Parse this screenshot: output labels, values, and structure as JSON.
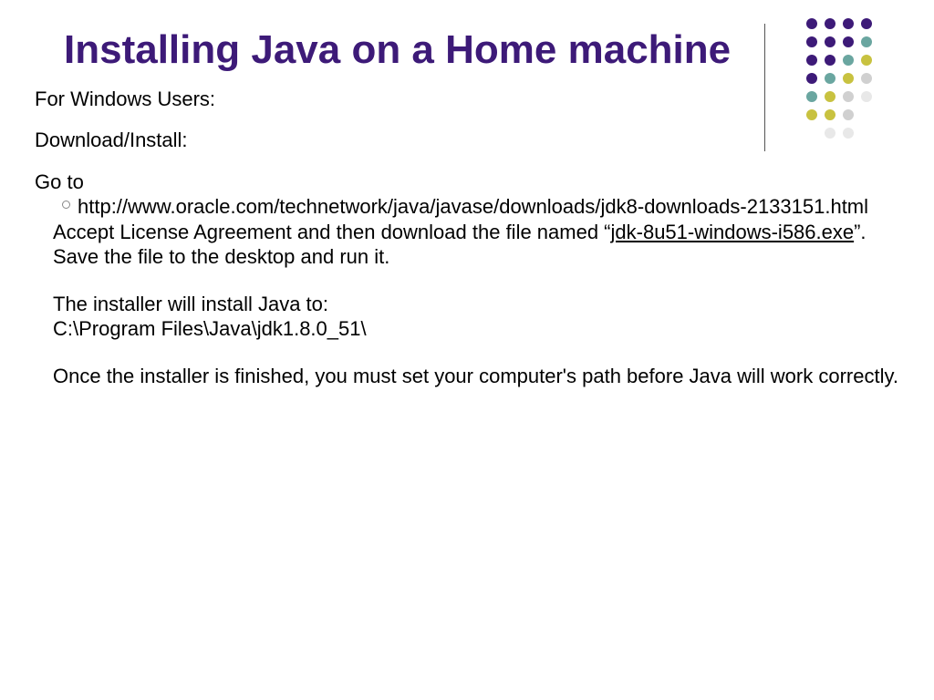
{
  "title": "Installing Java on a Home machine",
  "body": {
    "forWindows": "For Windows Users:",
    "downloadInstall": "Download/Install:",
    "goto": "Go to",
    "url": "http://www.oracle.com/technetwork/java/javase/downloads/jdk8-downloads-2133151.html",
    "accept_pre": "Accept License Agreement and then download the file named “",
    "file_name": "jdk-8u51-windows-i586.exe",
    "accept_post": "”.",
    "saveRun": "Save the file to the desktop and run it.",
    "installTo1": "The installer will install Java to:",
    "installTo2": "C:\\Program Files\\Java\\jdk1.8.0_51\\",
    "finished": "Once the installer is finished, you must set your computer's path before Java will work correctly."
  }
}
